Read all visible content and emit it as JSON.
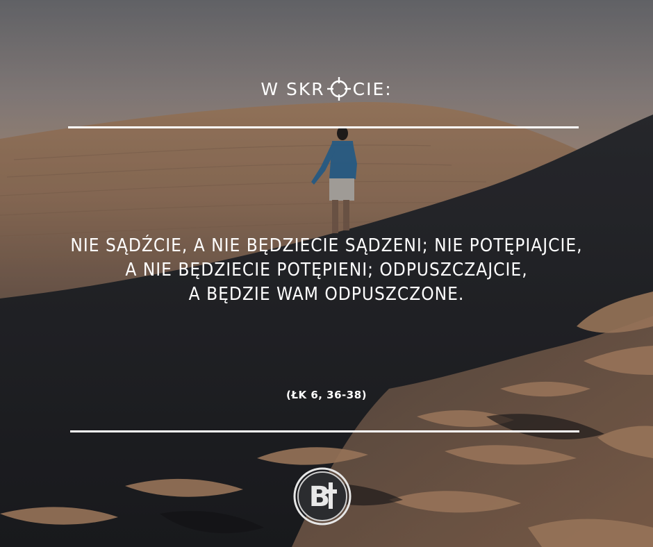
{
  "image": {
    "description_icon": "desert-dunes-photo",
    "heading": {
      "before": "W SKR",
      "after": "CIE:",
      "icon": "crosshair-icon"
    },
    "quote_lines": [
      "NIE SĄDŹCIE, A NIE BĘDZIECIE SĄDZENI; NIE POTĘPIAJCIE,",
      "A NIE BĘDZIECIE POTĘPIENI; ODPUSZCZAJCIE,",
      "A BĘDZIE WAM ODPUSZCZONE."
    ],
    "reference": "(ŁK 6, 36-38)",
    "logo": {
      "text": "B",
      "icon": "cross-icon"
    },
    "colors": {
      "text": "#ffffff",
      "rules": "#ffffff",
      "sky": "#8a898c",
      "sand_light": "#b58f72",
      "sand_shadow": "#26272b"
    }
  }
}
